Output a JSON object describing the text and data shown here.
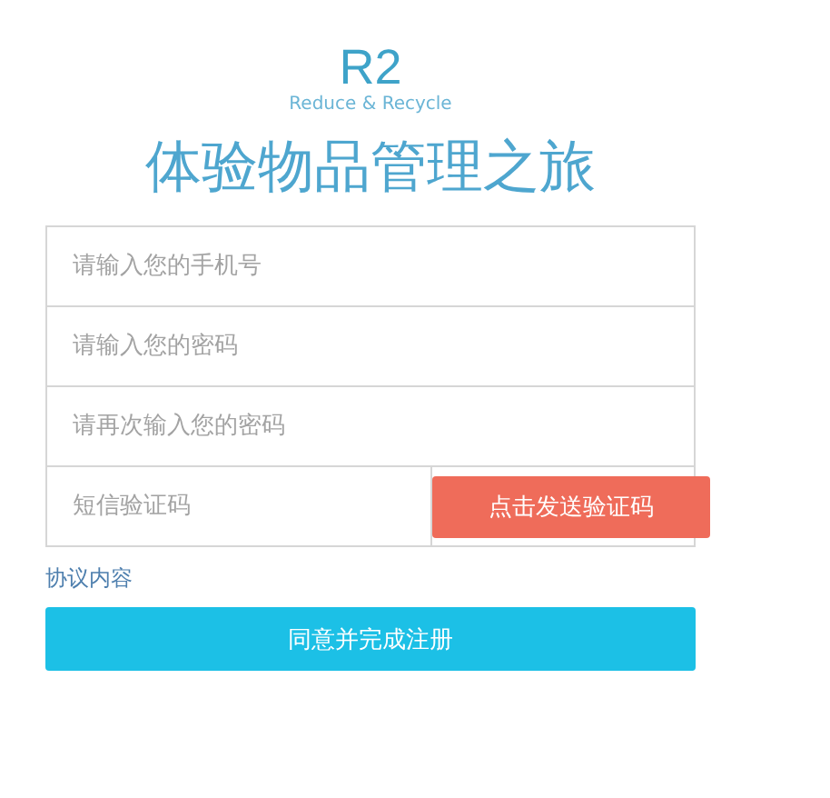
{
  "logo": {
    "mark": "R2",
    "tagline": "Reduce & Recycle"
  },
  "title": "体验物品管理之旅",
  "fields": [
    {
      "placeholder": "请输入您的手机号"
    },
    {
      "placeholder": "请输入您的密码"
    },
    {
      "placeholder": "请再次输入您的密码"
    }
  ],
  "sms": {
    "placeholder": "短信验证码",
    "button": "点击发送验证码"
  },
  "agreement_link": "协议内容",
  "submit": "同意并完成注册"
}
